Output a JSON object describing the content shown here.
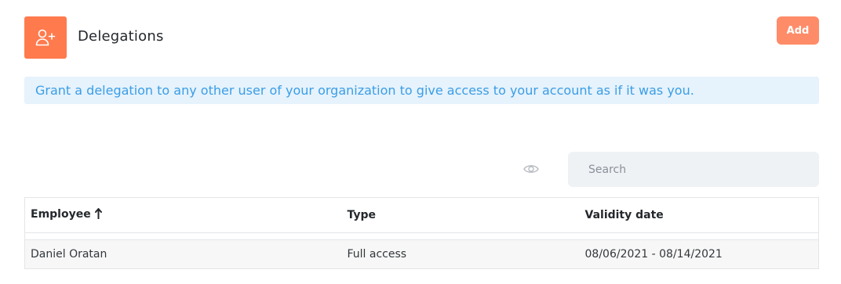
{
  "header": {
    "title": "Delegations",
    "icon": "add-user-icon",
    "accent_color": "#ff7a4d",
    "add_label": "Add"
  },
  "banner": {
    "text": "Grant a delegation to any other user of your organization to give access to your account as if it was you."
  },
  "toolbar": {
    "visibility_icon": "eye-icon",
    "search_placeholder": "Search",
    "search_value": ""
  },
  "table": {
    "columns": [
      "Employee",
      "Type",
      "Validity date"
    ],
    "sorted_column": "Employee",
    "sort_direction": "ascending",
    "rows": [
      {
        "employee": "Daniel Oratan",
        "type": "Full access",
        "validity": "08/06/2021 - 08/14/2021"
      }
    ]
  }
}
